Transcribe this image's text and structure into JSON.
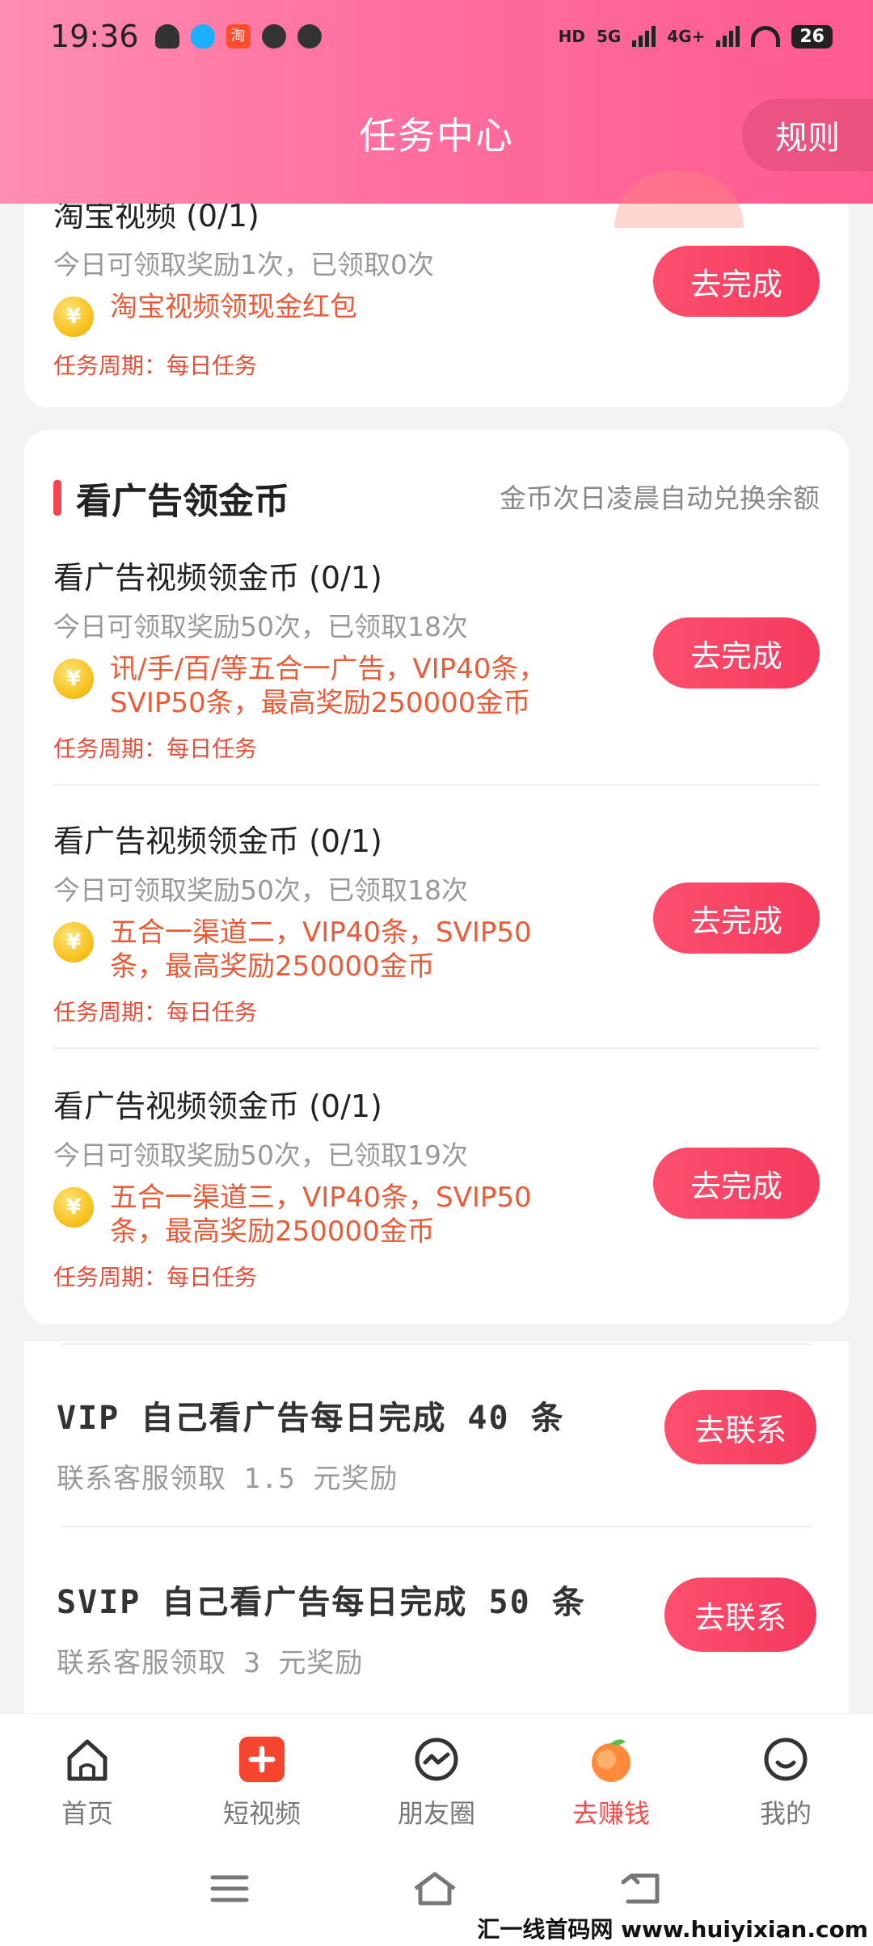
{
  "status_bar": {
    "time": "19:36",
    "hd": "HD",
    "net1": "5G",
    "net2": "4G+",
    "battery": "26"
  },
  "header": {
    "title": "任务中心",
    "rules_label": "规则"
  },
  "taobao_task": {
    "title": "淘宝视频 (0/1)",
    "sub": "今日可领取奖励1次，已领取0次",
    "reward": "淘宝视频领现金红包",
    "cycle": "任务周期：每日任务",
    "button": "去完成"
  },
  "ad_section": {
    "title": "看广告领金币",
    "note": "金币次日凌晨自动兑换余额",
    "tasks": [
      {
        "title": "看广告视频领金币 (0/1)",
        "sub": "今日可领取奖励50次，已领取18次",
        "reward": "讯/手/百/等五合一广告，VIP40条，SVIP50条，最高奖励250000金币",
        "cycle": "任务周期：每日任务",
        "button": "去完成"
      },
      {
        "title": "看广告视频领金币 (0/1)",
        "sub": "今日可领取奖励50次，已领取18次",
        "reward": "五合一渠道二，VIP40条，SVIP50条，最高奖励250000金币",
        "cycle": "任务周期：每日任务",
        "button": "去完成"
      },
      {
        "title": "看广告视频领金币 (0/1)",
        "sub": "今日可领取奖励50次，已领取19次",
        "reward": "五合一渠道三，VIP40条，SVIP50条，最高奖励250000金币",
        "cycle": "任务周期：每日任务",
        "button": "去完成"
      }
    ]
  },
  "vip_rows": [
    {
      "title": "VIP 自己看广告每日完成 40 条",
      "sub": "联系客服领取 1.5 元奖励",
      "button": "去联系"
    },
    {
      "title": "SVIP 自己看广告每日完成 50 条",
      "sub": "联系客服领取 3 元奖励",
      "button": "去联系"
    }
  ],
  "bottom_nav": {
    "items": [
      {
        "label": "首页",
        "icon": "home-icon"
      },
      {
        "label": "短视频",
        "icon": "plus-video-icon"
      },
      {
        "label": "朋友圈",
        "icon": "moments-icon"
      },
      {
        "label": "去赚钱",
        "icon": "peach-icon",
        "active": true
      },
      {
        "label": "我的",
        "icon": "smile-icon"
      }
    ]
  },
  "watermark": "汇一线首码网 www.huiyixian.com",
  "colors": {
    "accent": "#f43a5e",
    "header": "#ff6f9f",
    "reward_text": "#ec5b37"
  }
}
